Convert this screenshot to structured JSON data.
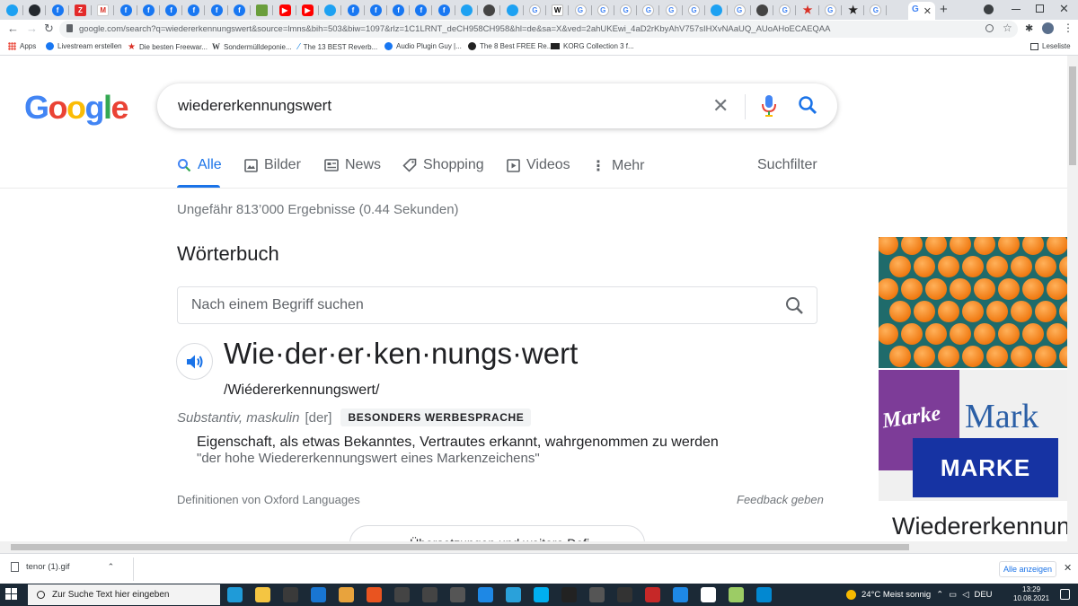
{
  "browser": {
    "url": "google.com/search?q=wiedererkennungswert&source=lmns&bih=503&biw=1097&rlz=1C1LRNT_deCH958CH958&hl=de&sa=X&ved=2ahUKEwi_4aD2rKbyAhV757sIHXvNAaUQ_AUoAHoECAEQAA",
    "active_tab_icon": "google-icon",
    "new_tab_glyph": "+",
    "bookmarks": [
      {
        "label": "Apps",
        "icon": "apps-grid-icon"
      },
      {
        "label": "Livestream erstellen",
        "icon": "facebook-icon"
      },
      {
        "label": "Die besten Freewar...",
        "icon": "star-icon"
      },
      {
        "label": "Sondermülldeponie...",
        "icon": "wikipedia-icon"
      },
      {
        "label": "The 13 BEST Reverb...",
        "icon": "plugin-icon"
      },
      {
        "label": "Audio Plugin Guy |...",
        "icon": "facebook-icon"
      },
      {
        "label": "The 8 Best FREE Re...",
        "icon": "dark-circle-icon"
      },
      {
        "label": "KORG Collection 3 f...",
        "icon": "korg-icon"
      }
    ],
    "reading_list": "Leseliste"
  },
  "google": {
    "logo": "Google",
    "query": "wiedererkennungswert",
    "tabs": [
      {
        "label": "Alle",
        "icon": "search-icon",
        "active": true
      },
      {
        "label": "Bilder",
        "icon": "image-icon"
      },
      {
        "label": "News",
        "icon": "news-icon"
      },
      {
        "label": "Shopping",
        "icon": "tag-icon"
      },
      {
        "label": "Videos",
        "icon": "play-icon"
      },
      {
        "label": "Mehr",
        "icon": "more-vert-icon"
      }
    ],
    "search_tools": "Suchfilter",
    "result_stats": "Ungefähr 813’000 Ergebnisse (0.44 Sekunden)",
    "colors": {
      "accent": "#1a73e8",
      "blue": "#4285f4",
      "red": "#ea4335",
      "yellow": "#fbbc05",
      "green": "#34a853"
    }
  },
  "dictionary": {
    "heading": "Wörterbuch",
    "search_placeholder": "Nach einem Begriff suchen",
    "headword": "Wie·der·er·ken·nungs·wert",
    "pronunciation": "/Wiédererkennungswert/",
    "pos": "Substantiv, maskulin",
    "article": "[der]",
    "tag": "BESONDERS WERBESPRACHE",
    "definition": "Eigenschaft, als etwas Bekanntes, Vertrautes erkannt, wahrgenommen zu werden",
    "example": "\"der hohe Wiedererkennungswert eines Markenzeichens\"",
    "source": "Definitionen von Oxford Languages",
    "feedback": "Feedback geben",
    "more_button": "Übersetzungen und weitere Defi..."
  },
  "knowledge_panel": {
    "title": "Wiedererkennun",
    "image2_text_script": "Marke",
    "image2_text_serif": "Mark",
    "image2_text_block": "MARKE"
  },
  "downloads": {
    "file": "tenor (1).gif",
    "show_all": "Alle anzeigen"
  },
  "taskbar": {
    "search_placeholder": "Zur Suche Text hier eingeben",
    "weather": "24°C  Meist sonnig",
    "language": "DEU",
    "time": "13:29",
    "date": "10.08.2021"
  }
}
